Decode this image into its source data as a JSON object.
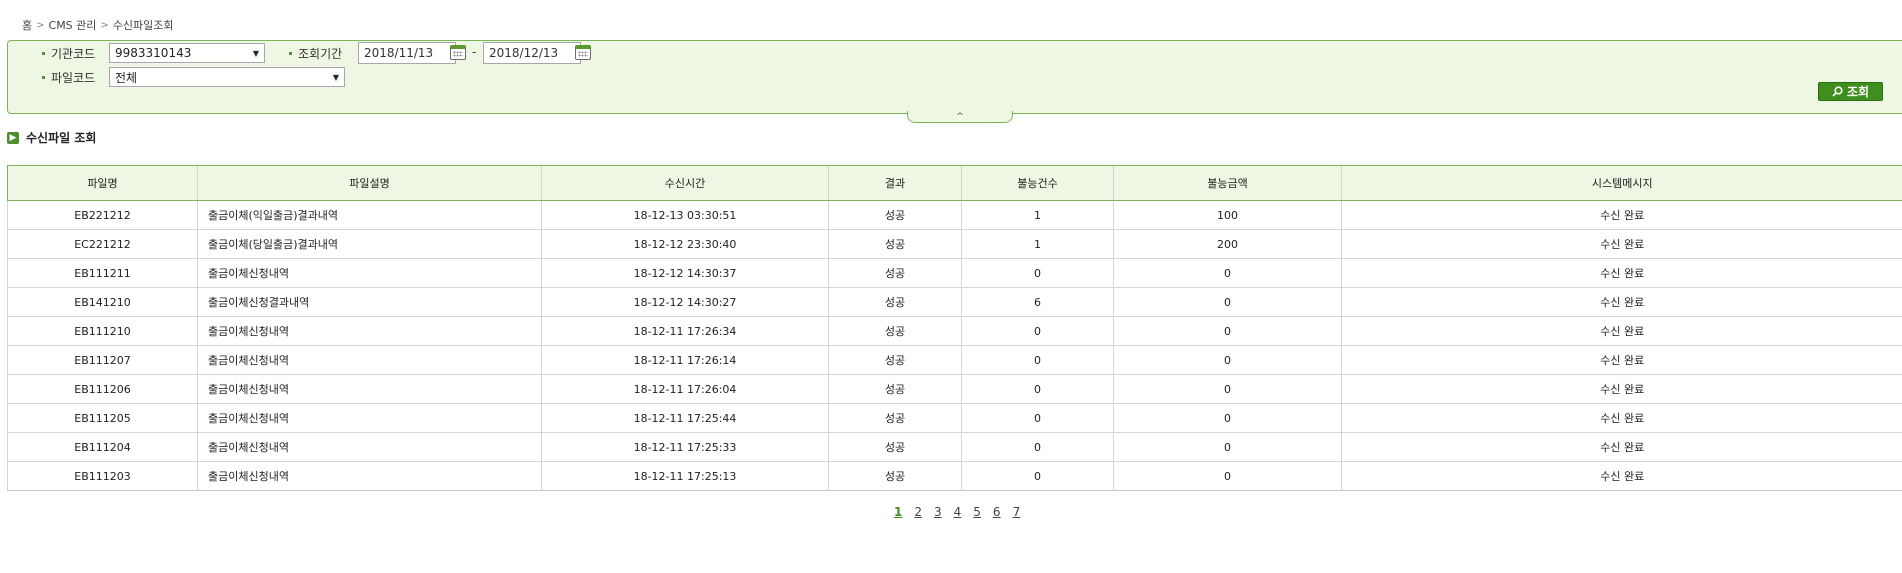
{
  "breadcrumb": [
    "홈",
    "CMS 관리",
    "수신파일조회"
  ],
  "search": {
    "org_code_label": "기관코드",
    "org_code_value": "9983310143",
    "period_label": "조회기간",
    "date_from": "2018/11/13",
    "date_to": "2018/12/13",
    "date_sep": "-",
    "file_code_label": "파일코드",
    "file_code_value": "전체",
    "search_button": "조회"
  },
  "section_title": "수신파일 조회",
  "table": {
    "headers": [
      "파일명",
      "파일설명",
      "수신시간",
      "결과",
      "불능건수",
      "불능금액",
      "시스템메시지"
    ],
    "rows": [
      [
        "EB221212",
        "출금이체(익일출금)결과내역",
        "18-12-13 03:30:51",
        "성공",
        "1",
        "100",
        "수신 완료"
      ],
      [
        "EC221212",
        "출금이체(당일출금)결과내역",
        "18-12-12 23:30:40",
        "성공",
        "1",
        "200",
        "수신 완료"
      ],
      [
        "EB111211",
        "출금이체신청내역",
        "18-12-12 14:30:37",
        "성공",
        "0",
        "0",
        "수신 완료"
      ],
      [
        "EB141210",
        "출금이체신청결과내역",
        "18-12-12 14:30:27",
        "성공",
        "6",
        "0",
        "수신 완료"
      ],
      [
        "EB111210",
        "출금이체신청내역",
        "18-12-11 17:26:34",
        "성공",
        "0",
        "0",
        "수신 완료"
      ],
      [
        "EB111207",
        "출금이체신청내역",
        "18-12-11 17:26:14",
        "성공",
        "0",
        "0",
        "수신 완료"
      ],
      [
        "EB111206",
        "출금이체신청내역",
        "18-12-11 17:26:04",
        "성공",
        "0",
        "0",
        "수신 완료"
      ],
      [
        "EB111205",
        "출금이체신청내역",
        "18-12-11 17:25:44",
        "성공",
        "0",
        "0",
        "수신 완료"
      ],
      [
        "EB111204",
        "출금이체신청내역",
        "18-12-11 17:25:33",
        "성공",
        "0",
        "0",
        "수신 완료"
      ],
      [
        "EB111203",
        "출금이체신청내역",
        "18-12-11 17:25:13",
        "성공",
        "0",
        "0",
        "수신 완료"
      ]
    ]
  },
  "pagination": {
    "pages": [
      "1",
      "2",
      "3",
      "4",
      "5",
      "6",
      "7"
    ],
    "current": "1"
  },
  "colors": {
    "accent_green": "#3f8f1e",
    "panel_bg": "#eef6e4",
    "panel_border": "#7db45b"
  }
}
